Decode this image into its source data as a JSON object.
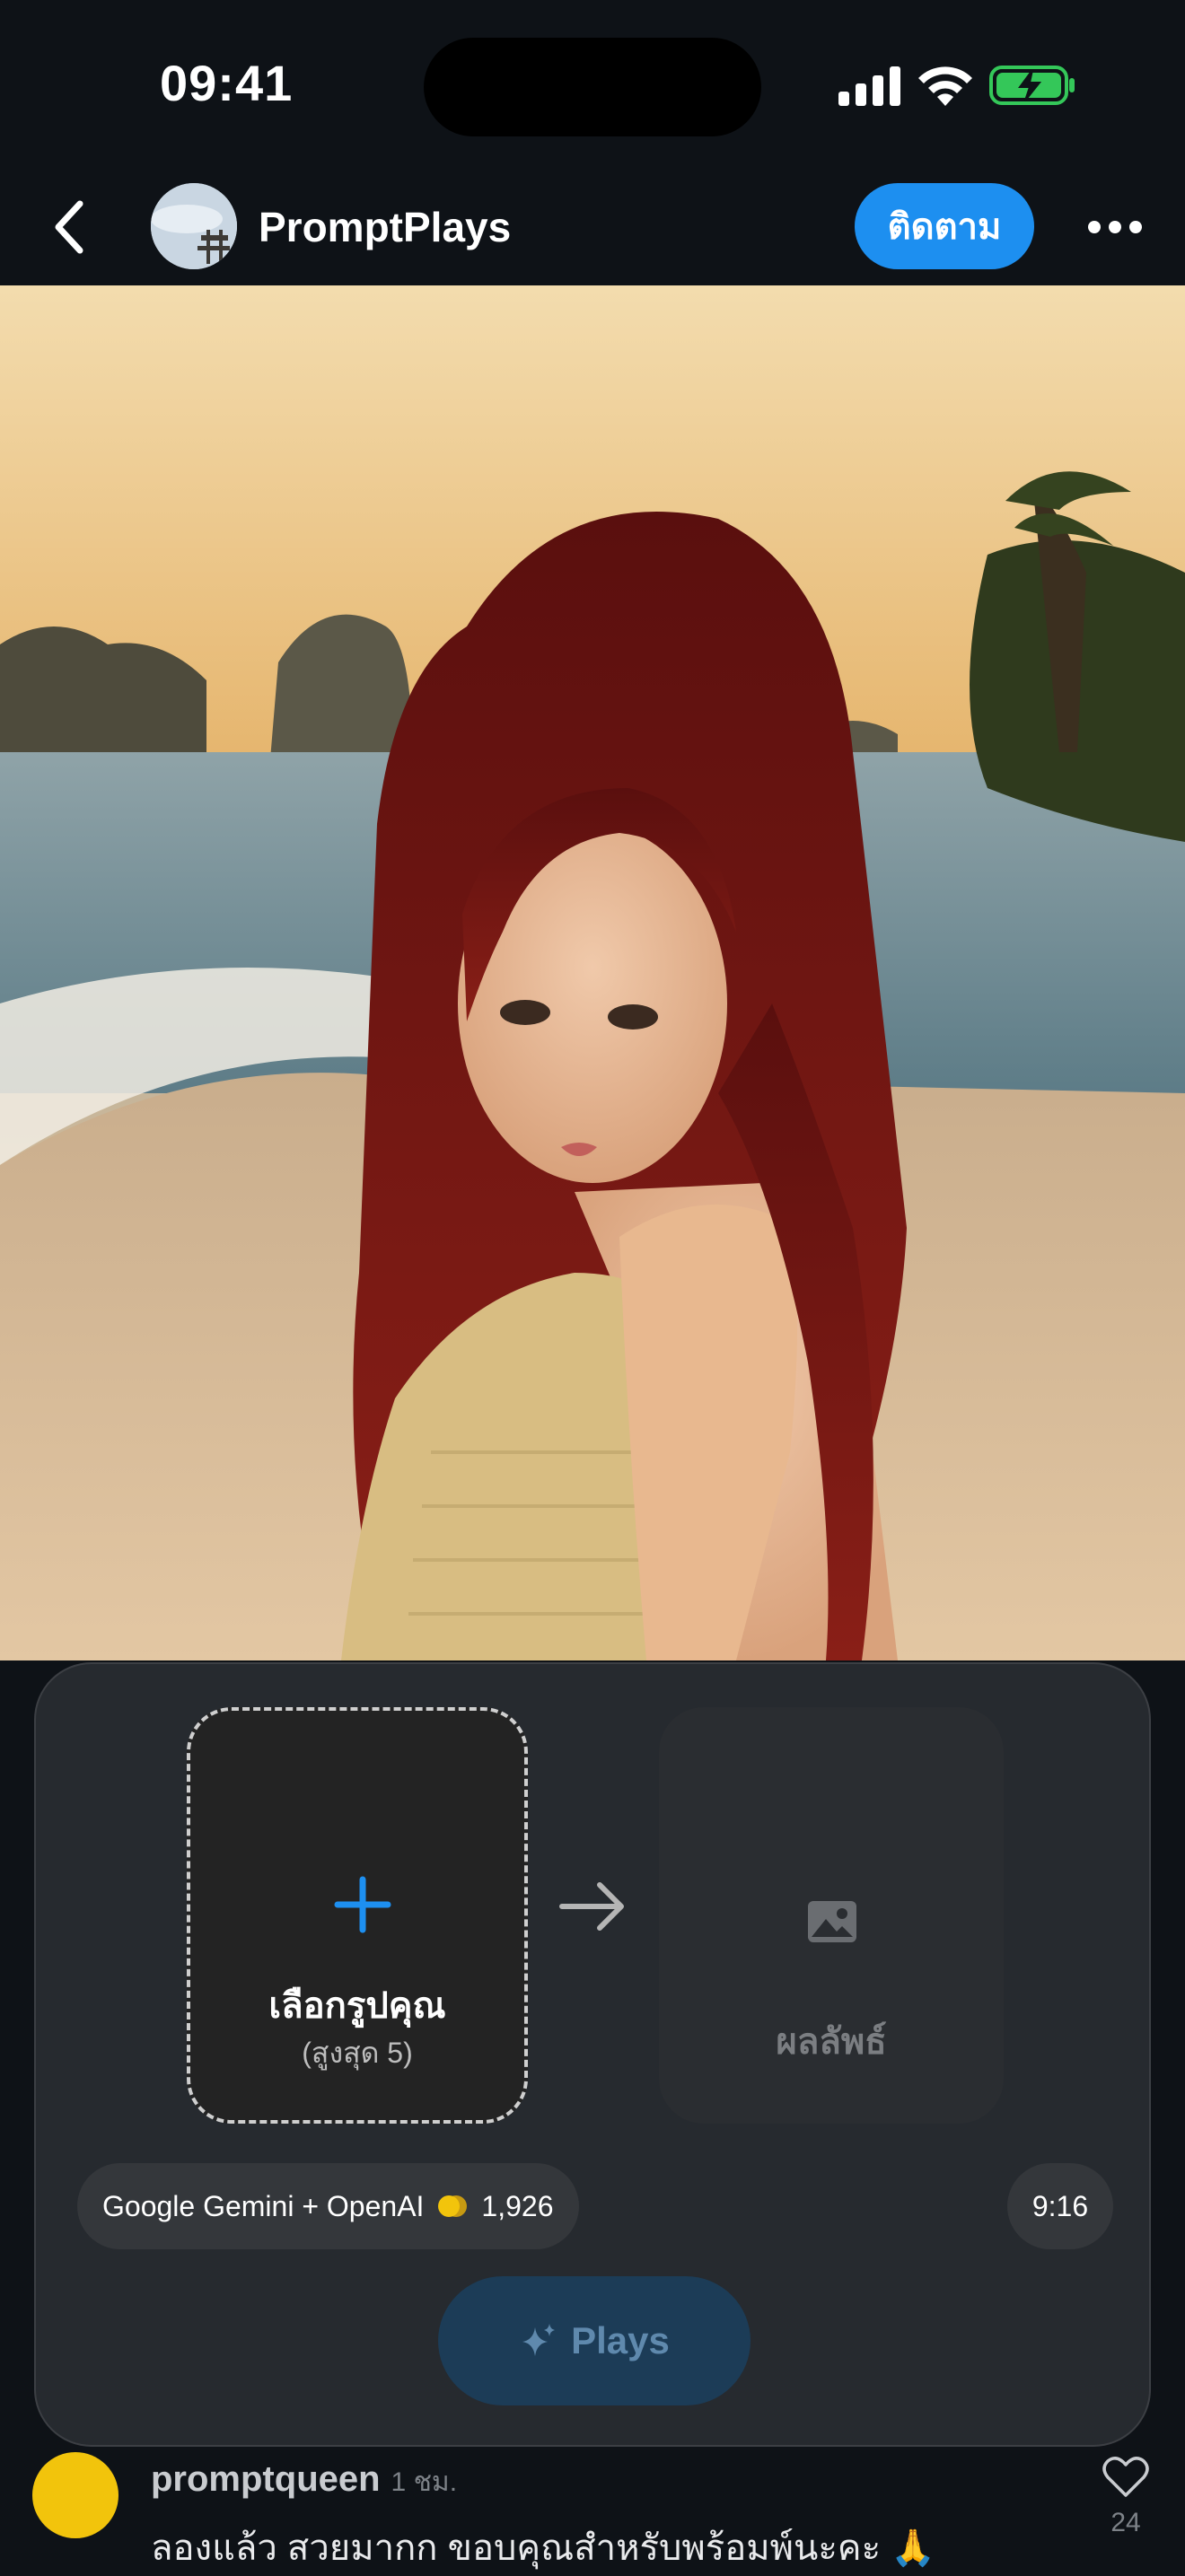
{
  "status_bar": {
    "time": "09:41",
    "icons": [
      "signal-icon",
      "wifi-icon",
      "battery-charging-icon"
    ],
    "battery_color": "#34c759"
  },
  "header": {
    "back_icon": "chevron-left-icon",
    "channel_name": "PromptPlays",
    "follow_label": "ติดตาม",
    "more_icon": "ellipsis-icon",
    "accent": "#1d8ff0"
  },
  "hero": {
    "image": "photo-woman-red-hair-beach-sunset"
  },
  "generator": {
    "upload_icon": "plus-icon",
    "upload_label": "เลือกรูปคุณ",
    "upload_sub": "(สูงสุด 5)",
    "arrow_icon": "arrow-right-icon",
    "result_icon": "image-icon",
    "result_label": "ผลลัพธ์",
    "model_label": "Google Gemini + OpenAI",
    "coin_icon": "coins-icon",
    "cost": "1,926",
    "ratio": "9:16",
    "plays_label": "Plays",
    "plays_icon": "sparkle-icon"
  },
  "comment": {
    "username": "promptqueen",
    "time": "1 ชม.",
    "text": "ลองแล้ว สวยมากก ขอบคุณสำหรับพร้อมพ์นะคะ 🙏",
    "like_icon": "heart-icon",
    "likes": "24"
  }
}
